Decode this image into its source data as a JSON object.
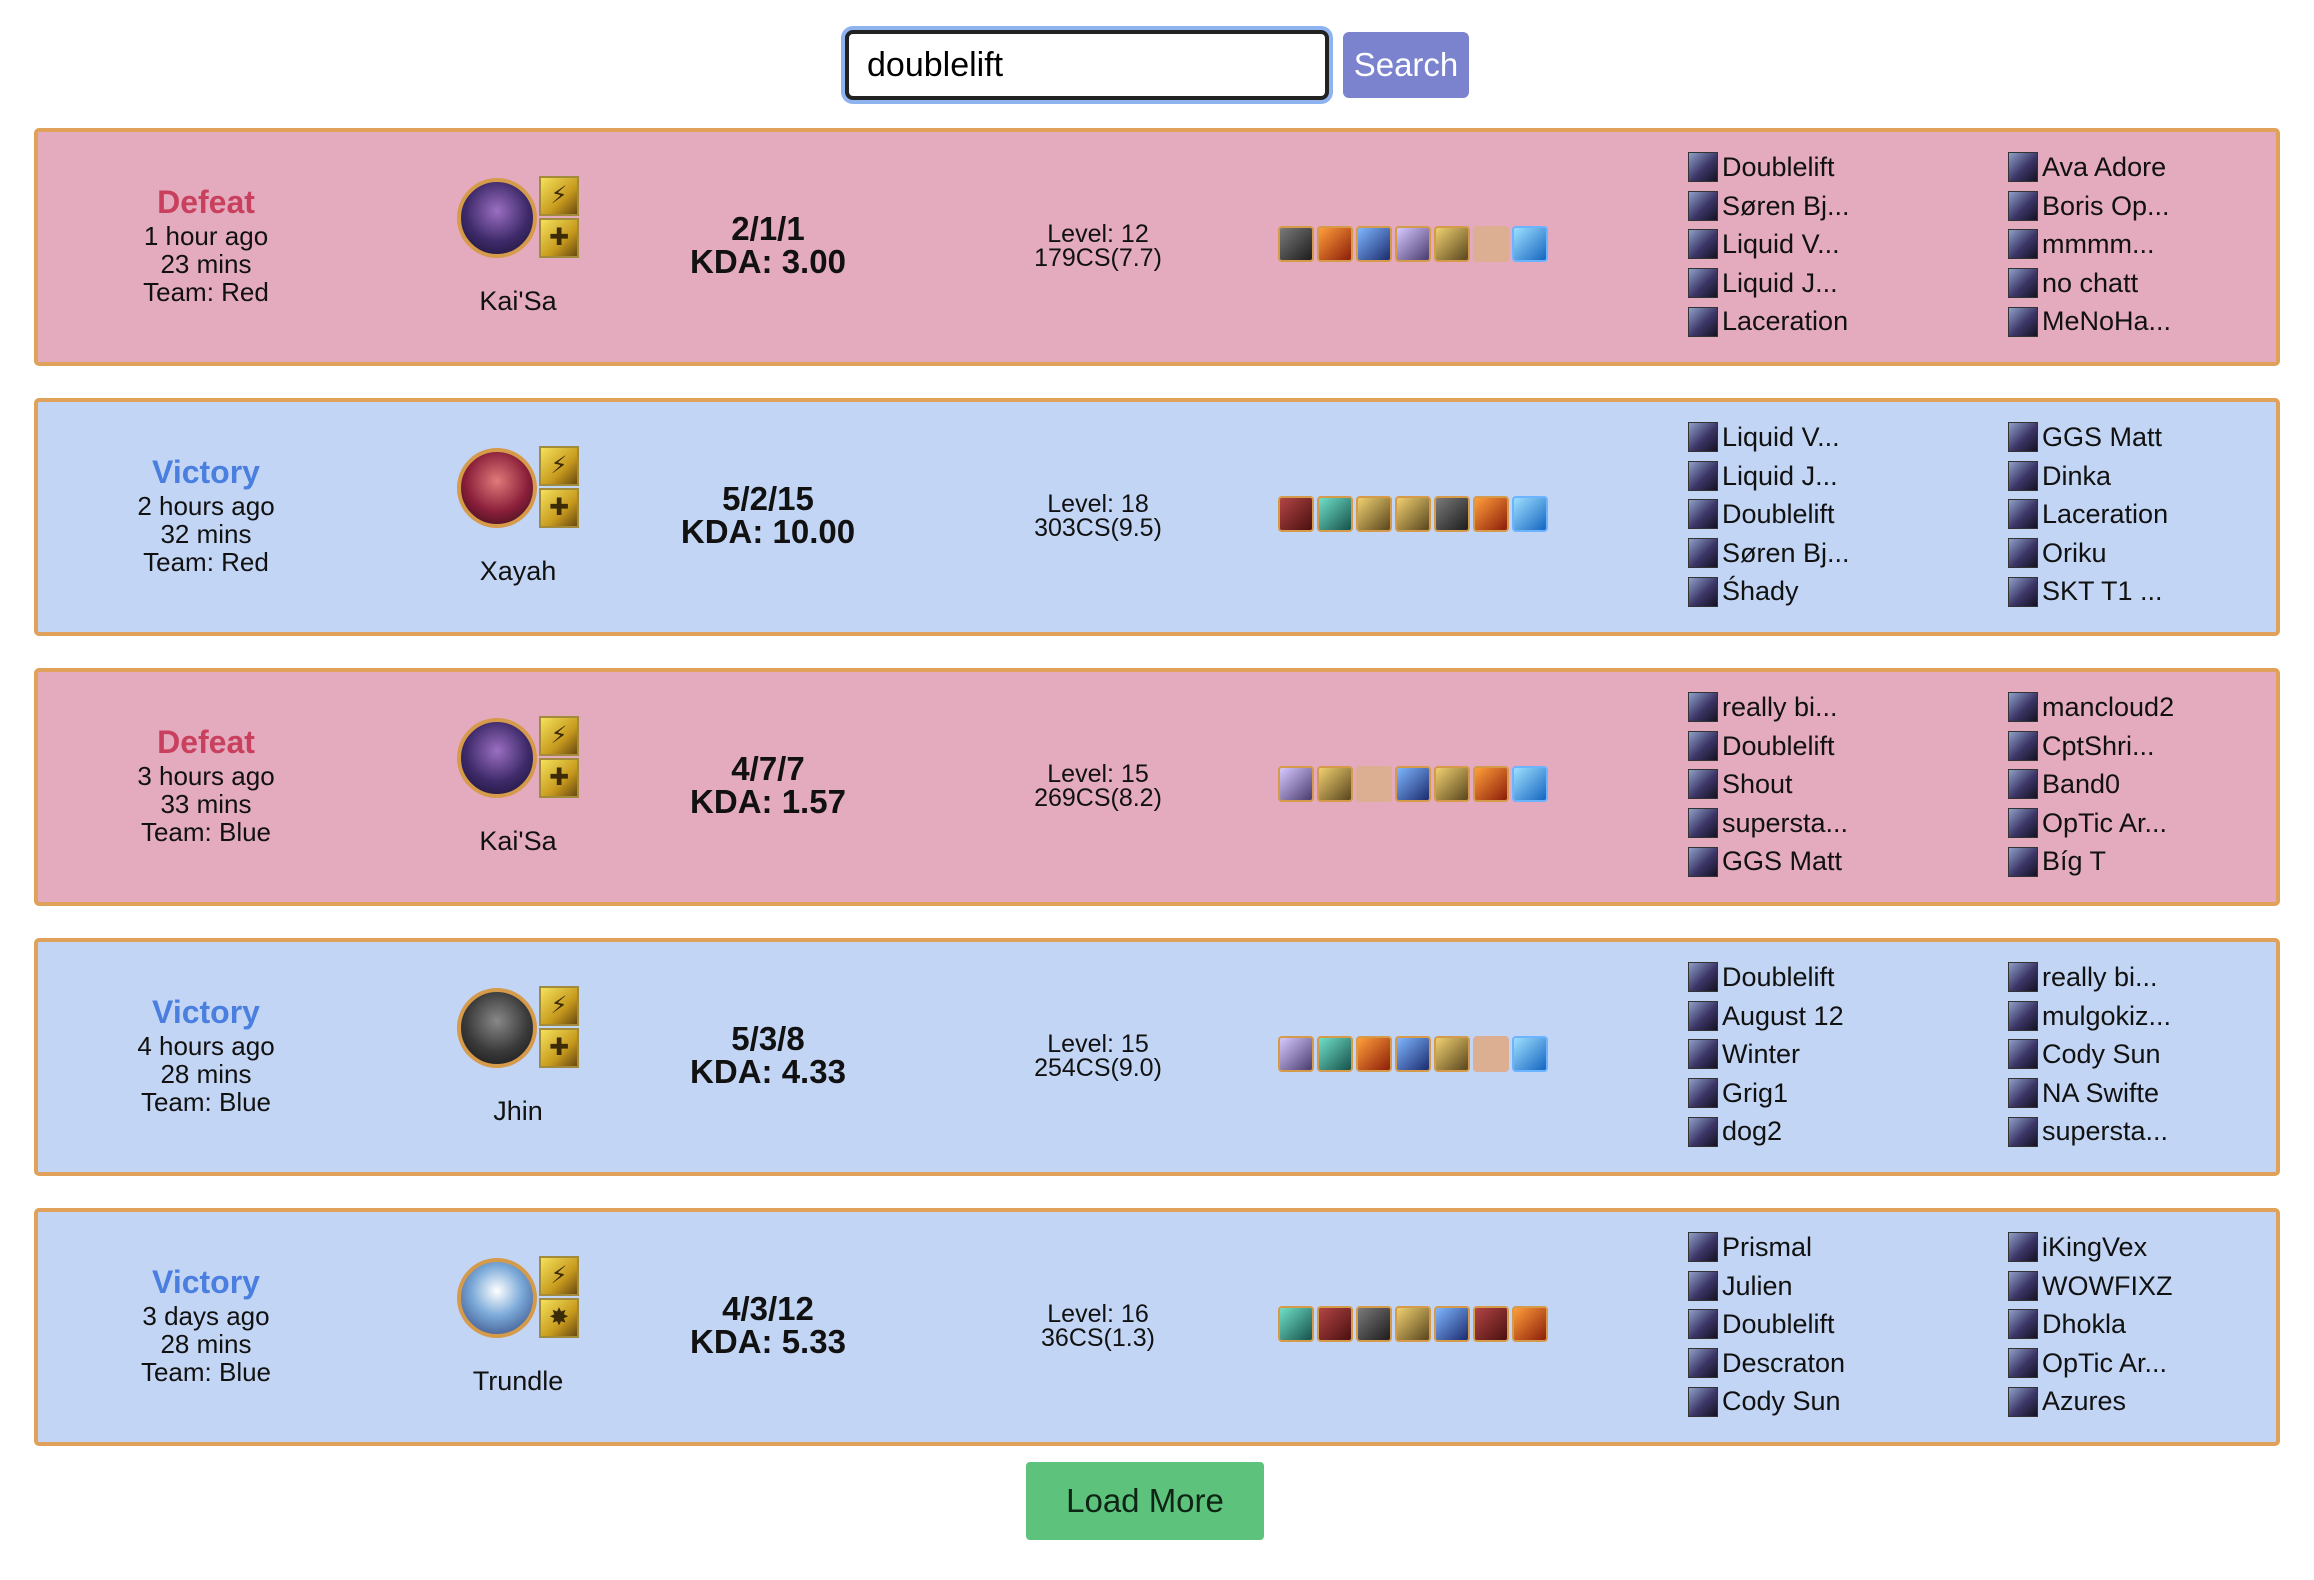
{
  "search": {
    "value": "doublelift",
    "button_label": "Search"
  },
  "load_more_label": "Load More",
  "colors": {
    "defeat_bg": "#e3abbd",
    "victory_bg": "#c3d5f4",
    "defeat_text": "#c9405e",
    "victory_text": "#4a7fe0",
    "border": "#e0a25a",
    "load_more": "#5cc27c",
    "search_button": "#7b83cf"
  },
  "matches": [
    {
      "result": "Defeat",
      "time_ago": "1 hour ago",
      "duration": "23 mins",
      "team": "Team: Red",
      "champion": "Kai'Sa",
      "portrait": "kaisa",
      "spells": [
        "flash-icon",
        "heal-icon"
      ],
      "score": "2/1/1",
      "kda": "KDA: 3.00",
      "level": "Level: 12",
      "cs": "179CS(7.7)",
      "items": [
        "c1",
        "c2",
        "c3",
        "c4",
        "c5",
        "empty",
        "c6"
      ],
      "team1": [
        "Doublelift",
        "Søren Bj...",
        "Liquid V...",
        "Liquid J...",
        "Laceration"
      ],
      "team2": [
        "Ava Adore",
        "Boris Op...",
        "mmmm...",
        "no chatt",
        "MeNoHa..."
      ]
    },
    {
      "result": "Victory",
      "time_ago": "2 hours ago",
      "duration": "32 mins",
      "team": "Team: Red",
      "champion": "Xayah",
      "portrait": "xayah",
      "spells": [
        "flash-icon",
        "heal-icon"
      ],
      "score": "5/2/15",
      "kda": "KDA: 10.00",
      "level": "Level: 18",
      "cs": "303CS(9.5)",
      "items": [
        "c7",
        "c8",
        "c5",
        "c5",
        "c1",
        "c2",
        "c6"
      ],
      "team1": [
        "Liquid V...",
        "Liquid J...",
        "Doublelift",
        "Søren Bj...",
        "Śhady"
      ],
      "team2": [
        "GGS Matt",
        "Dinka",
        "Laceration",
        "Oriku",
        "SKT T1 ..."
      ]
    },
    {
      "result": "Defeat",
      "time_ago": "3 hours ago",
      "duration": "33 mins",
      "team": "Team: Blue",
      "champion": "Kai'Sa",
      "portrait": "kaisa",
      "spells": [
        "flash-icon",
        "heal-icon"
      ],
      "score": "4/7/7",
      "kda": "KDA: 1.57",
      "level": "Level: 15",
      "cs": "269CS(8.2)",
      "items": [
        "c4",
        "c5",
        "empty",
        "c3",
        "c5",
        "c2",
        "c6"
      ],
      "team1": [
        "really bi...",
        "Doublelift",
        "Shout",
        "supersta...",
        "GGS Matt"
      ],
      "team2": [
        "mancloud2",
        "CptShri...",
        "Band0",
        "OpTic Ar...",
        "Bíg T"
      ]
    },
    {
      "result": "Victory",
      "time_ago": "4 hours ago",
      "duration": "28 mins",
      "team": "Team: Blue",
      "champion": "Jhin",
      "portrait": "jhin",
      "spells": [
        "flash-icon",
        "heal-icon"
      ],
      "score": "5/3/8",
      "kda": "KDA: 4.33",
      "level": "Level: 15",
      "cs": "254CS(9.0)",
      "items": [
        "c4",
        "c8",
        "c2",
        "c3",
        "c5",
        "empty",
        "c6"
      ],
      "team1": [
        "Doublelift",
        "August 12",
        "Winter",
        "Grig1",
        "dog2"
      ],
      "team2": [
        "really bi...",
        "mulgokiz...",
        "Cody Sun",
        "NA Swifte",
        "supersta..."
      ]
    },
    {
      "result": "Victory",
      "time_ago": "3 days ago",
      "duration": "28 mins",
      "team": "Team: Blue",
      "champion": "Trundle",
      "portrait": "trundle",
      "spells": [
        "flash-icon",
        "ignite-icon"
      ],
      "score": "4/3/12",
      "kda": "KDA: 5.33",
      "level": "Level: 16",
      "cs": "36CS(1.3)",
      "items": [
        "c8",
        "c7",
        "c1",
        "c5",
        "c3",
        "c7",
        "c2"
      ],
      "team1": [
        "Prismal",
        "Julien",
        "Doublelift",
        "Descraton",
        "Cody Sun"
      ],
      "team2": [
        "iKingVex",
        "WOWFIXZ",
        "Dhokla",
        "OpTic Ar...",
        "Azures"
      ]
    }
  ]
}
